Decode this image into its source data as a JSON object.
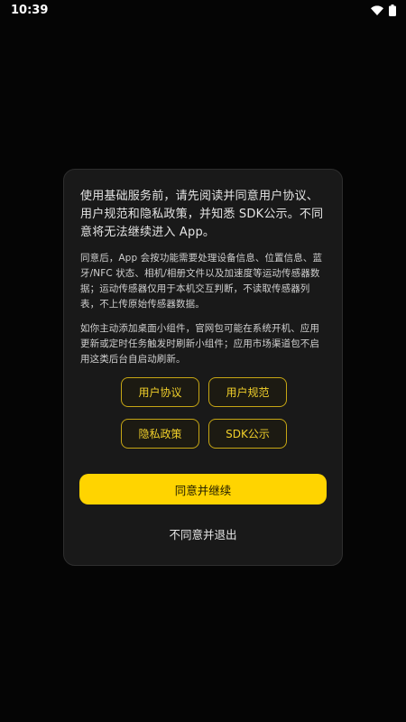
{
  "status_bar": {
    "time": "10:39",
    "icons": [
      "wifi-icon",
      "battery-icon"
    ]
  },
  "dialog": {
    "main_text": "使用基础服务前，请先阅读并同意用户协议、用户规范和隐私政策，并知悉 SDK公示。不同意将无法继续进入 App。",
    "sub_text_1": "同意后，App 会按功能需要处理设备信息、位置信息、蓝牙/NFC 状态、相机/相册文件以及加速度等运动传感器数据；运动传感器仅用于本机交互判断，不读取传感器列表，不上传原始传感器数据。",
    "sub_text_2": "如你主动添加桌面小组件，官网包可能在系统开机、应用更新或定时任务触发时刷新小组件；应用市场渠道包不启用这类后台自启动刷新。",
    "links": {
      "user_agreement": "用户协议",
      "user_norms": "用户规范",
      "privacy_policy": "隐私政策",
      "sdk_disclosure": "SDK公示"
    },
    "agree_button": "同意并继续",
    "disagree_button": "不同意并退出"
  },
  "colors": {
    "background": "#050505",
    "dialog_bg": "#191919",
    "accent": "#ffd400",
    "link_border": "#c6a614"
  }
}
